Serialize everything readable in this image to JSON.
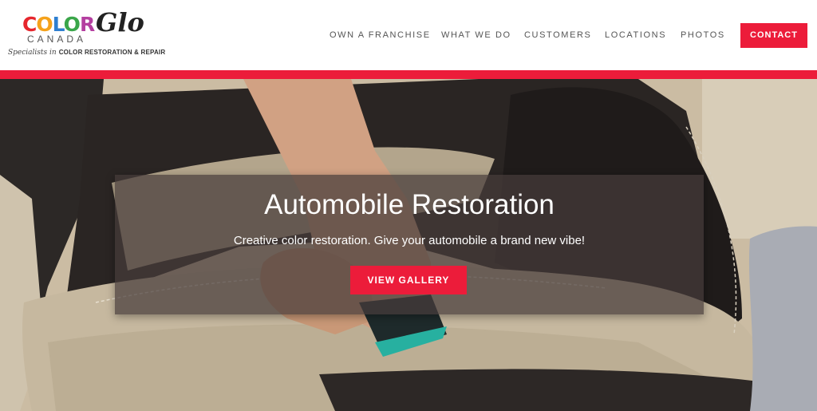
{
  "brand": {
    "logo_color": "COLOR",
    "logo_glo": "Glo",
    "logo_canada": "CANADA",
    "tagline_prefix": "Specialists in",
    "tagline_main": "COLOR RESTORATION & REPAIR"
  },
  "nav": {
    "items": [
      {
        "label": "OWN A FRANCHISE"
      },
      {
        "label": "WHAT WE DO"
      },
      {
        "label": "CUSTOMERS"
      },
      {
        "label": "LOCATIONS"
      },
      {
        "label": "PHOTOS"
      }
    ],
    "contact_label": "CONTACT"
  },
  "hero": {
    "title": "Automobile Restoration",
    "subtitle": "Creative color restoration. Give your automobile a brand new vibe!",
    "button_label": "VIEW GALLERY",
    "image_subject": "hand cleaning leather car seat with brush"
  },
  "colors": {
    "accent": "#ec1c3a",
    "nav_text": "#555555",
    "overlay": "#463c3a"
  }
}
